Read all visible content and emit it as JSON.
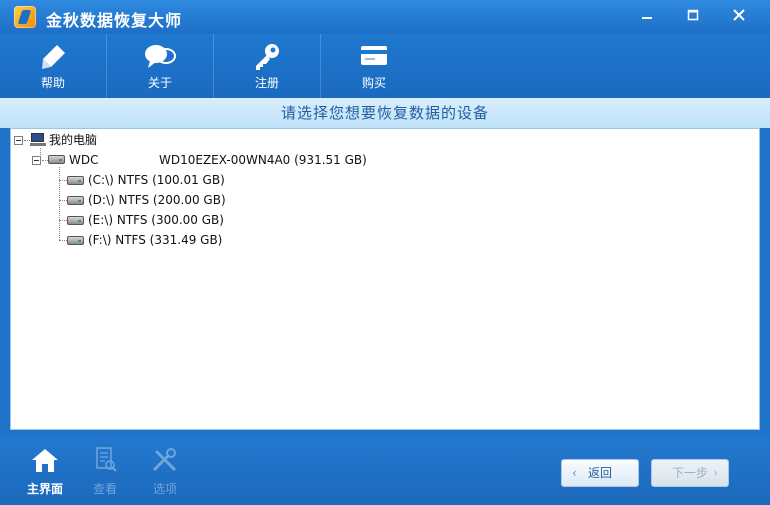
{
  "window": {
    "title": "金秋数据恢复大师"
  },
  "toolbar": {
    "items": [
      {
        "label": "帮助",
        "icon": "pen-icon"
      },
      {
        "label": "关于",
        "icon": "speech-bubbles-icon"
      },
      {
        "label": "注册",
        "icon": "key-icon"
      },
      {
        "label": "购买",
        "icon": "credit-card-icon"
      }
    ]
  },
  "subheader": "请选择您想要恢复数据的设备",
  "tree": {
    "root": "我的电脑",
    "disk": {
      "name": "WDC",
      "model": "WD10EZEX-00WN4A0 (931.51 GB)"
    },
    "partitions": [
      "(C:\\) NTFS (100.01 GB)",
      "(D:\\) NTFS (200.00 GB)",
      "(E:\\) NTFS (300.00 GB)",
      "(F:\\) NTFS (331.49 GB)"
    ]
  },
  "bottombar": {
    "items": [
      {
        "label": "主界面",
        "icon": "home-icon",
        "state": "active"
      },
      {
        "label": "查看",
        "icon": "document-search-icon",
        "state": "disabled"
      },
      {
        "label": "选项",
        "icon": "tools-icon",
        "state": "disabled"
      }
    ],
    "back_label": "返回",
    "next_label": "下一步"
  }
}
